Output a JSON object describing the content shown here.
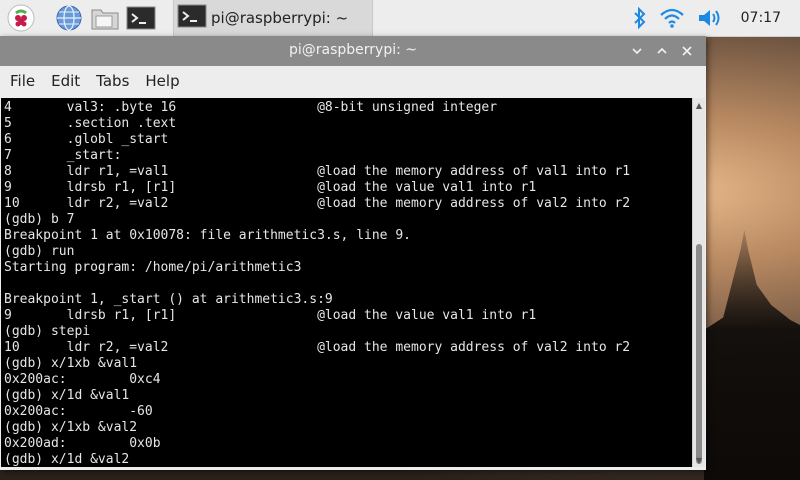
{
  "taskbar": {
    "task_label": "pi@raspberrypi: ~",
    "clock": "07:17",
    "launchers": [
      "raspberry-menu",
      "web-browser",
      "file-manager",
      "terminal"
    ],
    "tray": [
      "bluetooth-icon",
      "wifi-icon",
      "volume-icon"
    ]
  },
  "window": {
    "title": "pi@raspberrypi: ~",
    "menu": {
      "file": "File",
      "edit": "Edit",
      "tabs": "Tabs",
      "help": "Help"
    },
    "terminal_lines": [
      "4       val3: .byte 16                  @8-bit unsigned integer",
      "5       .section .text",
      "6       .globl _start",
      "7       _start:",
      "8       ldr r1, =val1                   @load the memory address of val1 into r1",
      "9       ldrsb r1, [r1]                  @load the value val1 into r1",
      "10      ldr r2, =val2                   @load the memory address of val2 into r2",
      "(gdb) b 7",
      "Breakpoint 1 at 0x10078: file arithmetic3.s, line 9.",
      "(gdb) run",
      "Starting program: /home/pi/arithmetic3",
      "",
      "Breakpoint 1, _start () at arithmetic3.s:9",
      "9       ldrsb r1, [r1]                  @load the value val1 into r1",
      "(gdb) stepi",
      "10      ldr r2, =val2                   @load the memory address of val2 into r2",
      "(gdb) x/1xb &val1",
      "0x200ac:        0xc4",
      "(gdb) x/1d &val1",
      "0x200ac:        -60",
      "(gdb) x/1xb &val2",
      "0x200ad:        0x0b",
      "(gdb) x/1d &val2"
    ]
  },
  "colors": {
    "terminal_bg": "#000000",
    "terminal_fg": "#e6e6e6",
    "titlebar": "#8a8a8a",
    "taskbar": "#ededed"
  }
}
